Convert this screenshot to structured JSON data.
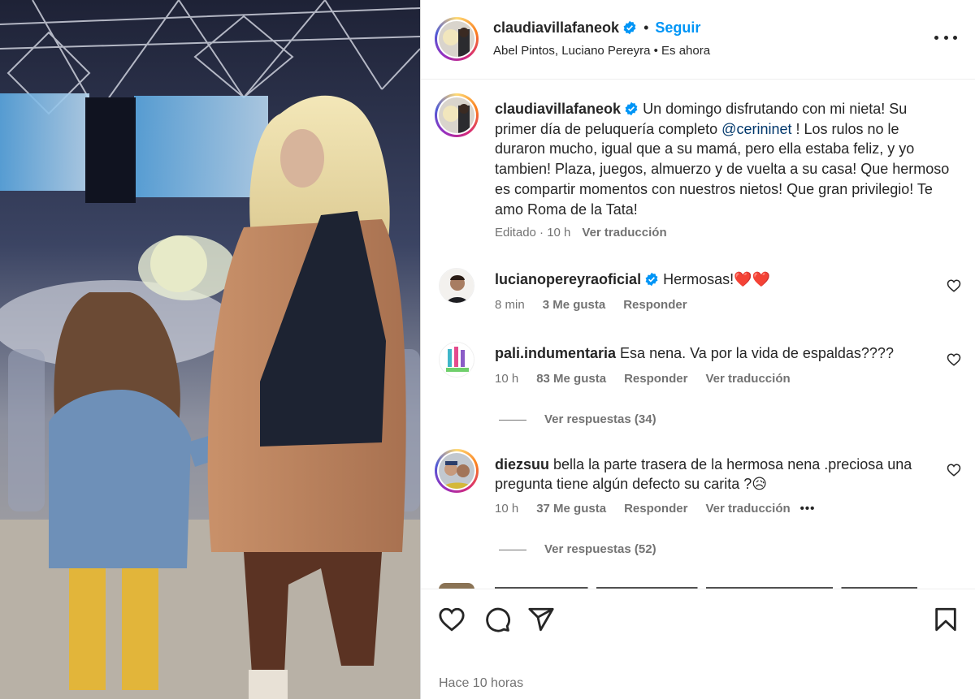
{
  "post": {
    "author": "claudiavillafaneok",
    "follow_label": "Seguir",
    "header_subtitle": "Abel Pintos, Luciano Pereyra • Es ahora",
    "separator": "•",
    "caption_pre": "Un domingo disfrutando con mi nieta! Su primer día de peluquería completo ",
    "caption_mention": "@cerininet",
    "caption_post": " ! Los rulos no le duraron mucho, igual que a su mamá, pero ella estaba feliz, y yo tambien! Plaza, juegos, almuerzo y de vuelta a su casa! Que hermoso es compartir momentos con nuestros nietos! Que gran privilegio! Te amo Roma de la Tata!",
    "caption_edited": "Editado · 10 h",
    "caption_translate": "Ver traducción",
    "timestamp": "Hace 10 horas"
  },
  "comments": [
    {
      "user": "lucianopereyraoficial",
      "text": "Hermosas!❤️❤️",
      "time": "8 min",
      "likes": "3 Me gusta",
      "reply": "Responder"
    },
    {
      "user": "pali.indumentaria",
      "text": "Esa nena. Va por la vida de espaldas????",
      "time": "10 h",
      "likes": "83 Me gusta",
      "reply": "Responder",
      "translate": "Ver traducción",
      "replies": "Ver respuestas (34)"
    },
    {
      "user": "diezsuu",
      "text": "bella la parte trasera de la hermosa nena .preciosa una pregunta tiene algún defecto su carita ?😥",
      "time": "10 h",
      "likes": "37 Me gusta",
      "reply": "Responder",
      "translate": "Ver traducción",
      "more": "•••",
      "replies": "Ver respuestas (52)"
    }
  ],
  "icons": {
    "like": "heart-icon",
    "comment": "comment-icon",
    "share": "share-icon",
    "save": "bookmark-icon",
    "verified": "verified-badge-icon",
    "more": "more-options-icon"
  },
  "colors": {
    "link": "#0095f6",
    "verified": "#0095f6",
    "secondary_text": "#737373",
    "mention": "#00376b"
  }
}
